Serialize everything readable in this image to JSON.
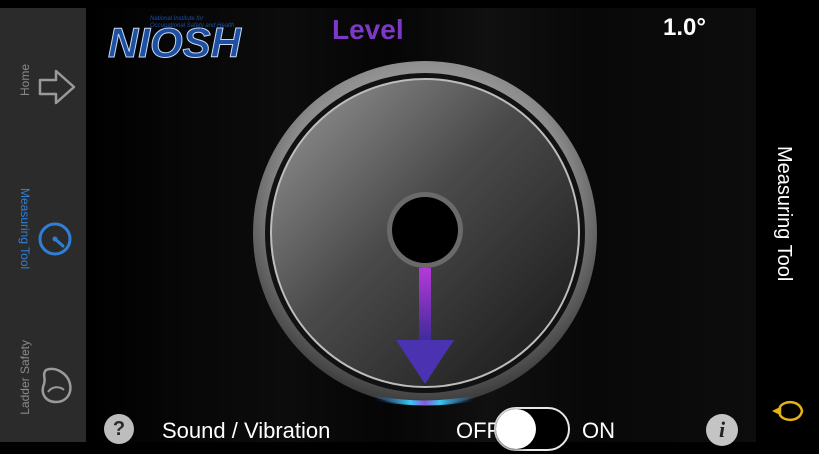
{
  "tabs": [
    {
      "label": "Home",
      "icon": "arrow-right-icon",
      "state": "inactive"
    },
    {
      "label": "Measuring Tool",
      "icon": "gauge-icon",
      "state": "active"
    },
    {
      "label": "Ladder Safety",
      "icon": "ladder-shoe-icon",
      "state": "inactive"
    }
  ],
  "logo": {
    "text": "NIOSH",
    "tagline_line1": "National Institute for",
    "tagline_line2": "Occupational Safety and Health"
  },
  "header": {
    "title": "Level",
    "angle": "1.0°"
  },
  "footer": {
    "help_icon_text": "?",
    "sound_label": "Sound / Vibration",
    "toggle_off": "OFF",
    "toggle_on": "ON",
    "info_icon_text": "i"
  },
  "sidebar": {
    "title": "Measuring Tool",
    "icon": "light-bulb-icon"
  },
  "colors": {
    "accent_blue": "#2f7fd6",
    "title_purple": "#7d39c6",
    "arrow_purple": "#5a3aa6",
    "logo_blue": "#1d4fa3",
    "bulb_yellow": "#e6b21a"
  }
}
